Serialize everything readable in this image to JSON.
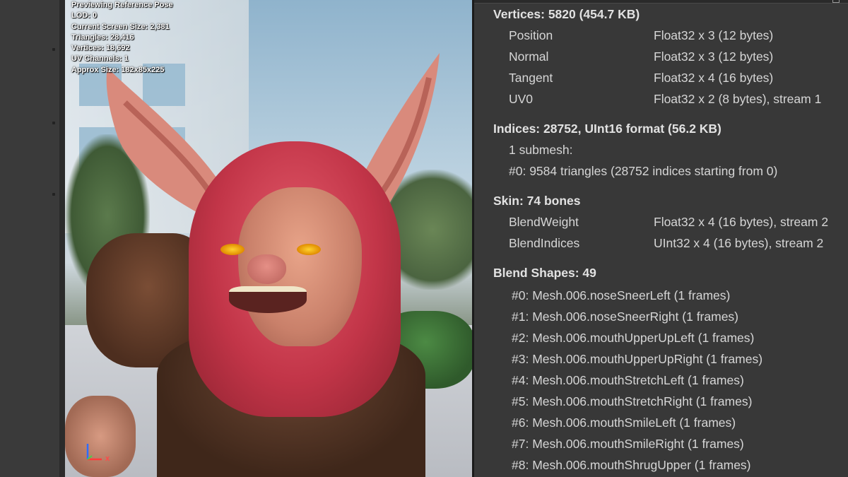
{
  "viewport": {
    "overlay_lines": [
      "Previewing Reference Pose",
      "LOD: 0",
      "Current Screen Size: 2,381",
      "Triangles: 28,416",
      "Vertices: 18,692",
      "UV Channels: 1",
      "Approx Size: 182x85x225"
    ],
    "axis_x_label": "x"
  },
  "inspector": {
    "vertices": {
      "title": "Vertices: 5820 (454.7 KB)",
      "attributes": [
        {
          "name": "Position",
          "format": "Float32 x 3 (12 bytes)"
        },
        {
          "name": "Normal",
          "format": "Float32 x 3 (12 bytes)"
        },
        {
          "name": "Tangent",
          "format": "Float32 x 4 (16 bytes)"
        },
        {
          "name": "UV0",
          "format": "Float32 x 2 (8 bytes), stream 1"
        }
      ]
    },
    "indices": {
      "title": "Indices: 28752, UInt16 format (56.2 KB)",
      "submesh_count": "1 submesh:",
      "submesh_detail": "#0: 9584 triangles (28752 indices starting from 0)"
    },
    "skin": {
      "title": "Skin: 74 bones",
      "attributes": [
        {
          "name": "BlendWeight",
          "format": "Float32 x 4 (16 bytes), stream 2"
        },
        {
          "name": "BlendIndices",
          "format": "UInt32 x 4 (16 bytes), stream 2"
        }
      ]
    },
    "blend_shapes": {
      "title": "Blend Shapes: 49",
      "items": [
        "#0: Mesh.006.noseSneerLeft (1 frames)",
        "#1: Mesh.006.noseSneerRight (1 frames)",
        "#2: Mesh.006.mouthUpperUpLeft (1 frames)",
        "#3: Mesh.006.mouthUpperUpRight (1 frames)",
        "#4: Mesh.006.mouthStretchLeft (1 frames)",
        "#5: Mesh.006.mouthStretchRight (1 frames)",
        "#6: Mesh.006.mouthSmileLeft (1 frames)",
        "#7: Mesh.006.mouthSmileRight (1 frames)",
        "#8: Mesh.006.mouthShrugUpper (1 frames)"
      ]
    }
  }
}
